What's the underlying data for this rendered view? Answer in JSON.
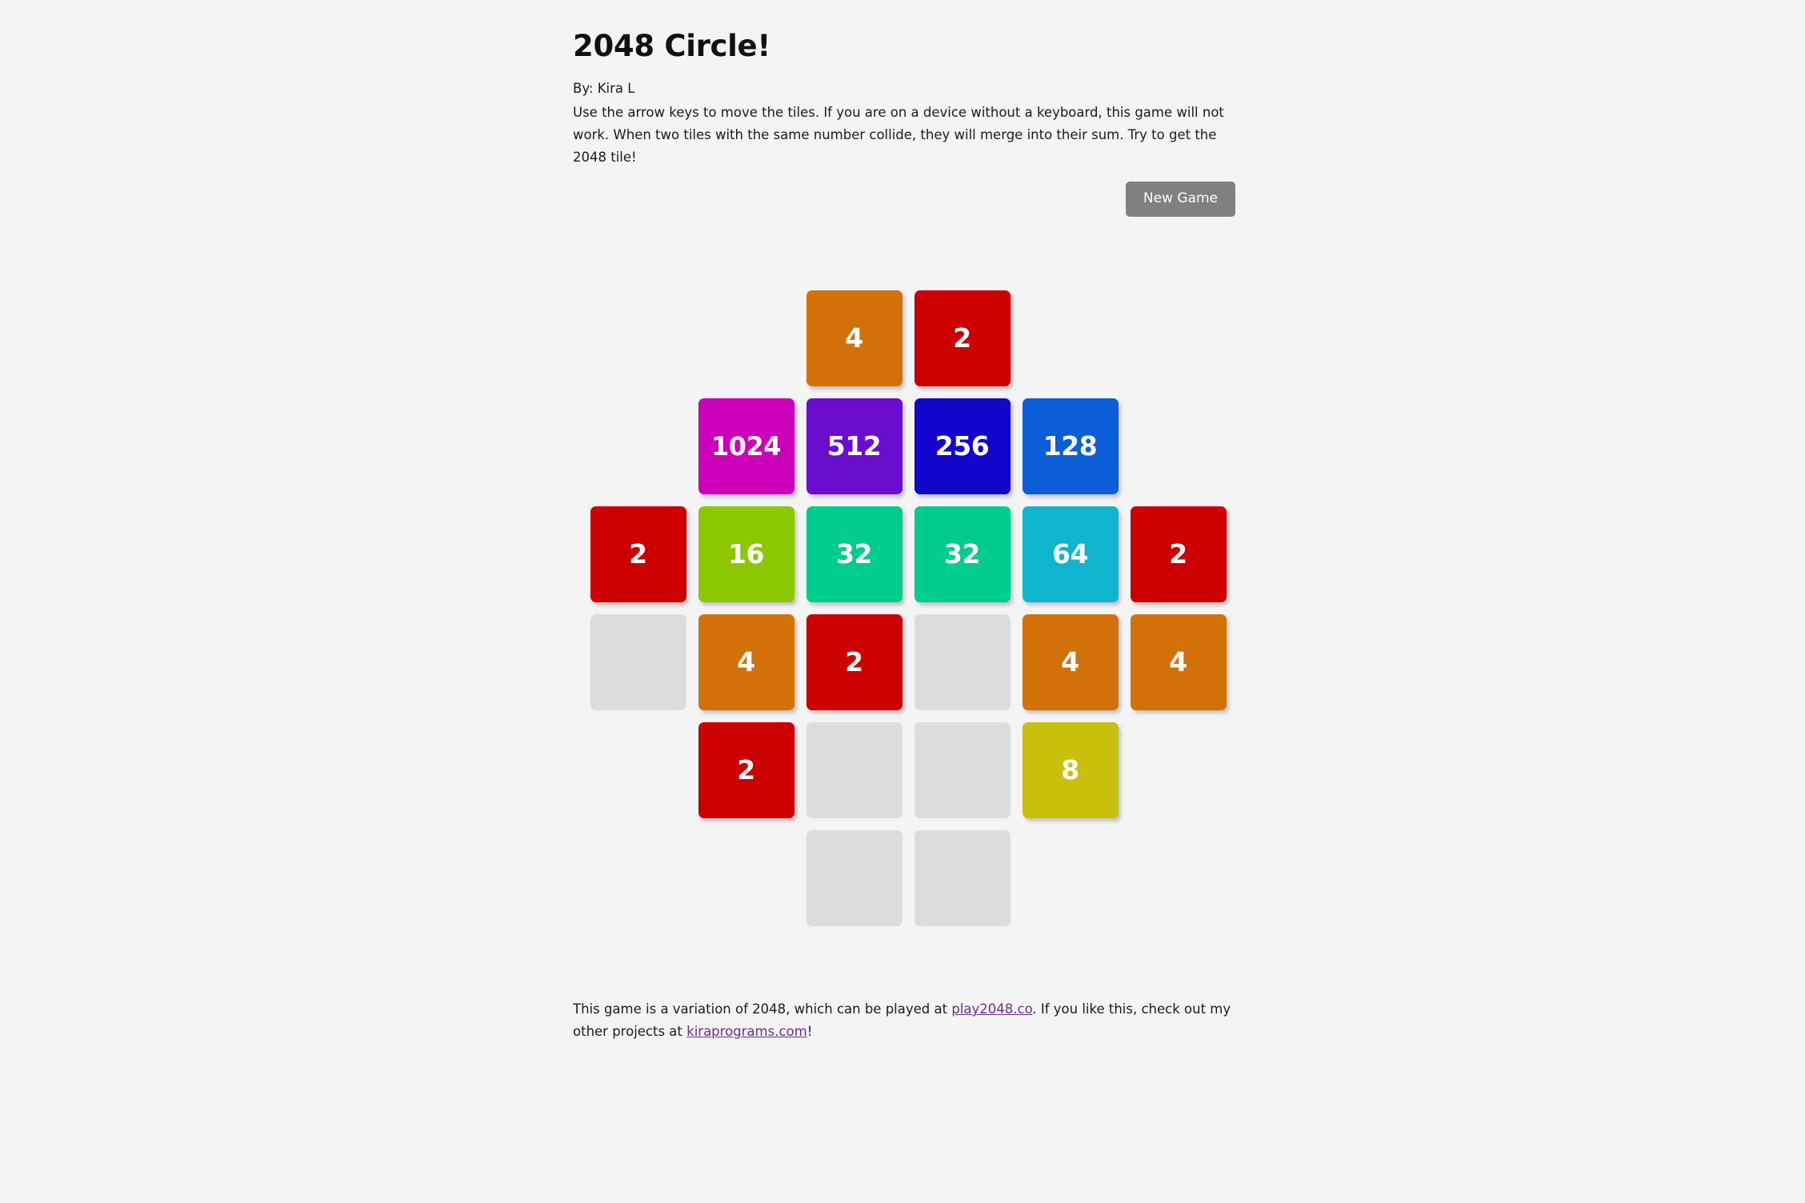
{
  "page": {
    "background_color": "#f5f4f4",
    "title": "2048 Circle!",
    "byline": "By: Kira L",
    "instructions": "Use the arrow keys to move the tiles. If you are on a device without a keyboard, this game will not work. When two tiles with the same number collide, they will merge into their sum. Try to get the 2048 tile!"
  },
  "controls": {
    "new_game_label": "New Game",
    "new_game_bg": "#808080",
    "new_game_text_color": "#ffffff"
  },
  "board": {
    "shape": "circle",
    "columns": 6,
    "rows": 6,
    "empty_tile_color": "#dcdcdc",
    "tile_text_color": "#ffffff",
    "tile_colors": {
      "2": "#cc0000",
      "4": "#d2700a",
      "8": "#c9c00c",
      "16": "#8cc800",
      "32": "#00cc8d",
      "64": "#0fb5cf",
      "128": "#0b5ed7",
      "256": "#1205cc",
      "512": "#6a0dce",
      "1024": "#cc00b8"
    },
    "grid": [
      [
        null,
        null,
        "4",
        "2",
        null,
        null
      ],
      [
        null,
        "1024",
        "512",
        "256",
        "128",
        null
      ],
      [
        "2",
        "16",
        "32",
        "32",
        "64",
        "2"
      ],
      [
        "",
        "4",
        "2",
        "",
        "4",
        "4"
      ],
      [
        null,
        "2",
        "",
        "",
        "8",
        null
      ],
      [
        null,
        null,
        "",
        "",
        null,
        null
      ]
    ]
  },
  "footer": {
    "text_before_link1": "This game is a variation of 2048, which can be played at ",
    "link1": "play2048.co",
    "text_between": ". If you like this, check out my other projects at ",
    "link2": "kiraprograms.com",
    "text_after": "!",
    "link_color": "#6a2f8f"
  }
}
